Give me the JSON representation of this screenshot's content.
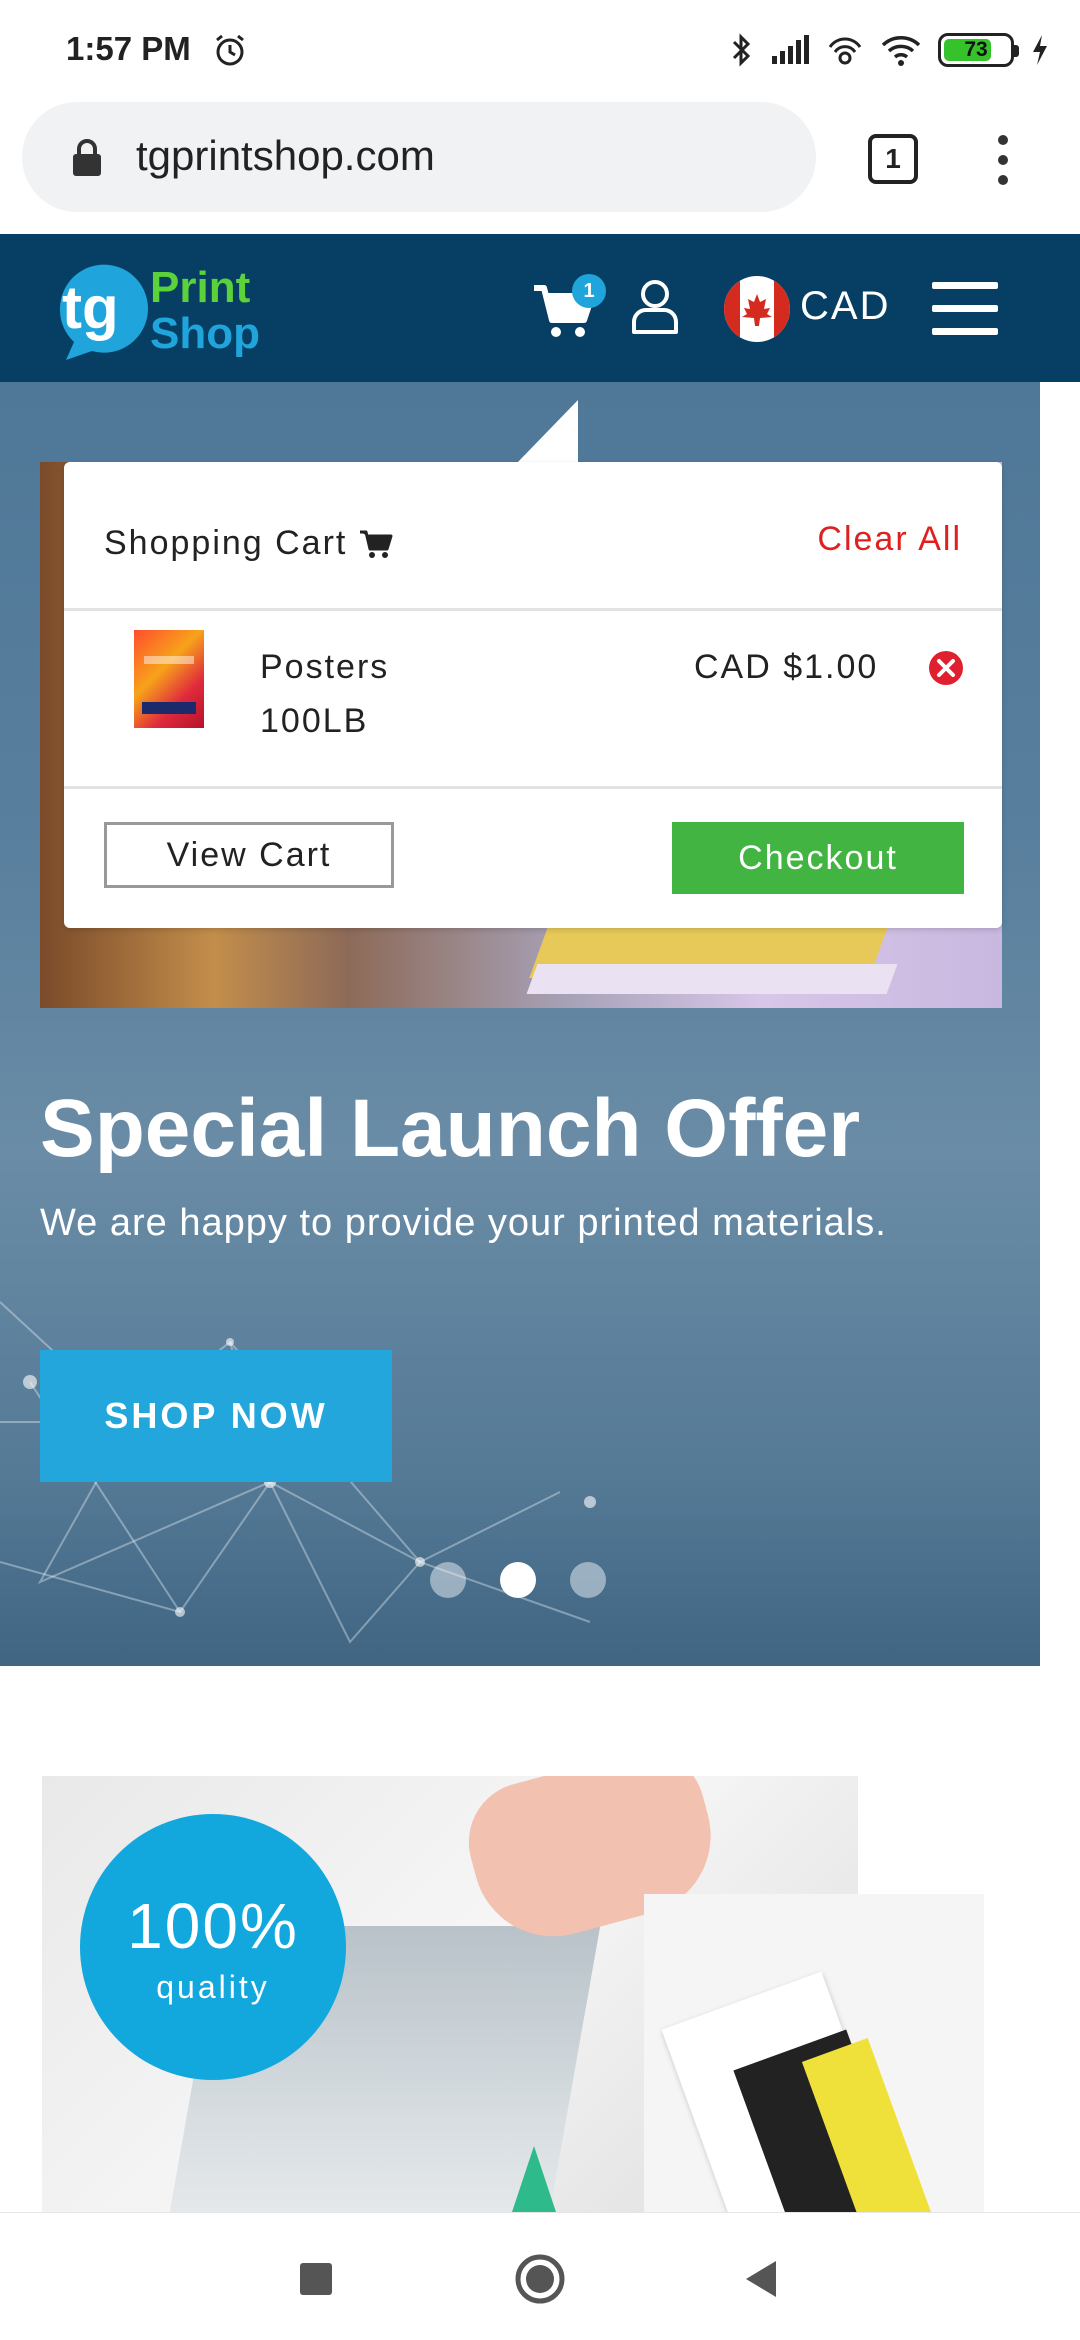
{
  "status_bar": {
    "time": "1:57 PM",
    "battery": "73",
    "battery_level": 0.73
  },
  "browser": {
    "url": "tgprintshop.com",
    "tab_count": "1"
  },
  "header": {
    "logo_tg": "tg",
    "logo_print": "Print",
    "logo_shop": "Shop",
    "cart_count": "1",
    "currency": "CAD"
  },
  "cart": {
    "title": "Shopping Cart",
    "clear_all": "Clear All",
    "items": [
      {
        "name": "Posters",
        "variant": "100LB",
        "price": "CAD $1.00",
        "thumb_top": "WAITING",
        "thumb_bottom": "NOW"
      }
    ],
    "view_cart": "View Cart",
    "checkout": "Checkout"
  },
  "hero": {
    "title": "Special Launch Offer",
    "subtitle": "We are happy to provide your printed materials.",
    "cta": "SHOP NOW",
    "slide_count": 3,
    "active_slide": 2
  },
  "feature": {
    "badge_value": "100%",
    "badge_label": "quality"
  },
  "colors": {
    "header_bg": "#063f63",
    "accent_blue": "#22a6db",
    "checkout_green": "#41b442",
    "clear_all_red": "#e02020"
  }
}
